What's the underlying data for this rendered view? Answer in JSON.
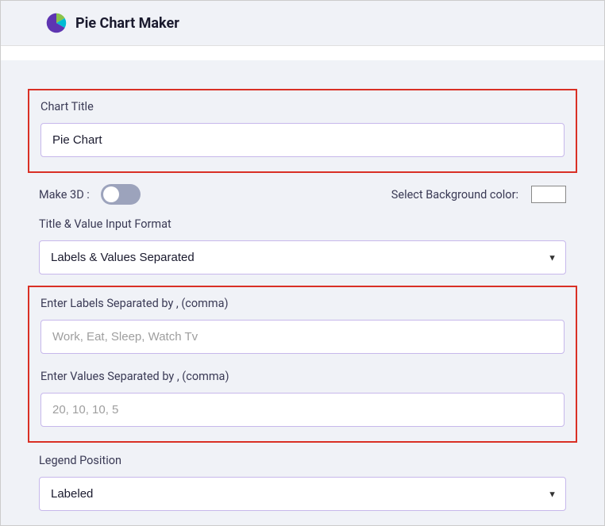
{
  "header": {
    "app_title": "Pie Chart Maker"
  },
  "form": {
    "chart_title_label": "Chart Title",
    "chart_title_value": "Pie Chart",
    "make3d_label": "Make 3D :",
    "bgcolor_label": "Select Background color:",
    "input_format_label": "Title & Value Input Format",
    "input_format_value": "Labels & Values Separated",
    "labels_label": "Enter Labels Separated by , (comma)",
    "labels_placeholder": "Work, Eat, Sleep, Watch Tv",
    "labels_value": "",
    "values_label": "Enter Values Separated by , (comma)",
    "values_placeholder": "20, 10, 10, 5",
    "values_value": "",
    "legend_label": "Legend Position",
    "legend_value": "Labeled"
  }
}
